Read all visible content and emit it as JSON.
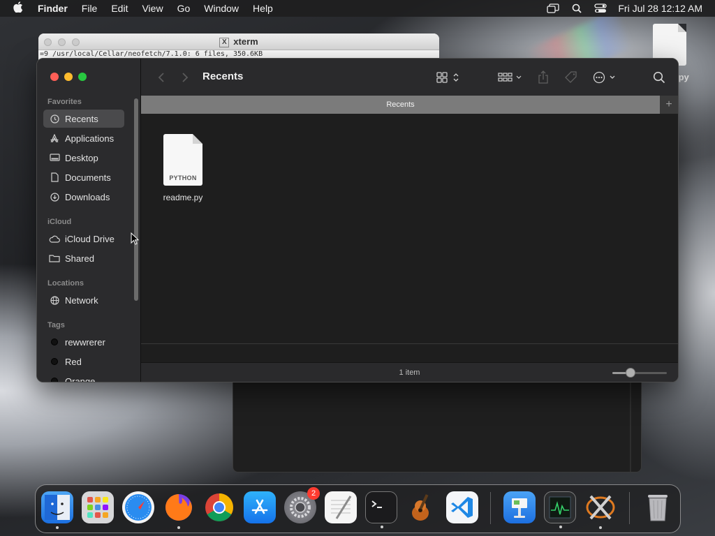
{
  "menubar": {
    "apple_icon": "apple-logo",
    "app_name": "Finder",
    "items": [
      "File",
      "Edit",
      "View",
      "Go",
      "Window",
      "Help"
    ],
    "status_icons": [
      "screen-mirroring-icon",
      "spotlight-search-icon",
      "control-center-icon"
    ],
    "clock": "Fri Jul 28  12:12 AM"
  },
  "desktop": {
    "file_label": ".py"
  },
  "xterm": {
    "title": "xterm",
    "line": "=9  /usr/local/Cellar/neofetch/7.1.0: 6 files, 350.6KB"
  },
  "finder": {
    "title": "Recents",
    "tab_label": "Recents",
    "sidebar": {
      "favorites_header": "Favorites",
      "favorites": [
        {
          "label": "Recents",
          "icon": "clock-icon",
          "selected": true
        },
        {
          "label": "Applications",
          "icon": "applications-icon"
        },
        {
          "label": "Desktop",
          "icon": "desktop-icon"
        },
        {
          "label": "Documents",
          "icon": "document-icon"
        },
        {
          "label": "Downloads",
          "icon": "download-icon"
        }
      ],
      "icloud_header": "iCloud",
      "icloud": [
        {
          "label": "iCloud Drive",
          "icon": "cloud-icon"
        },
        {
          "label": "Shared",
          "icon": "shared-folder-icon"
        }
      ],
      "locations_header": "Locations",
      "locations": [
        {
          "label": "Network",
          "icon": "network-globe-icon"
        }
      ],
      "tags_header": "Tags",
      "tags": [
        {
          "label": "rewwrerer",
          "color": "#111111"
        },
        {
          "label": "Red",
          "color": "#111111"
        },
        {
          "label": "Orange",
          "color": "#111111"
        }
      ]
    },
    "files": [
      {
        "name": "readme.py",
        "kind_label": "PYTHON"
      }
    ],
    "status": "1 item",
    "icon_size_level": 0.33
  },
  "dock": {
    "apps": [
      {
        "name": "Finder",
        "icon": "finder-icon",
        "running": true
      },
      {
        "name": "Launchpad",
        "icon": "launchpad-icon",
        "running": false
      },
      {
        "name": "Safari",
        "icon": "safari-icon",
        "running": false
      },
      {
        "name": "Firefox",
        "icon": "firefox-icon",
        "running": true
      },
      {
        "name": "Chrome",
        "icon": "chrome-icon",
        "running": false
      },
      {
        "name": "App Store",
        "icon": "app-store-icon",
        "running": false
      },
      {
        "name": "System Preferences",
        "icon": "system-preferences-icon",
        "running": false,
        "badge": "2"
      },
      {
        "name": "TextEdit",
        "icon": "textedit-icon",
        "running": false
      },
      {
        "name": "Terminal",
        "icon": "terminal-icon",
        "running": true
      },
      {
        "name": "GarageBand",
        "icon": "garageband-icon",
        "running": false
      },
      {
        "name": "Visual Studio Code",
        "icon": "vscode-icon",
        "running": false
      },
      {
        "name": "Keynote",
        "icon": "keynote-icon",
        "running": false
      },
      {
        "name": "Activity Monitor",
        "icon": "activity-monitor-icon",
        "running": true
      },
      {
        "name": "XQuartz",
        "icon": "xquartz-icon",
        "running": true
      },
      {
        "name": "Trash",
        "icon": "trash-icon",
        "running": false
      }
    ]
  }
}
